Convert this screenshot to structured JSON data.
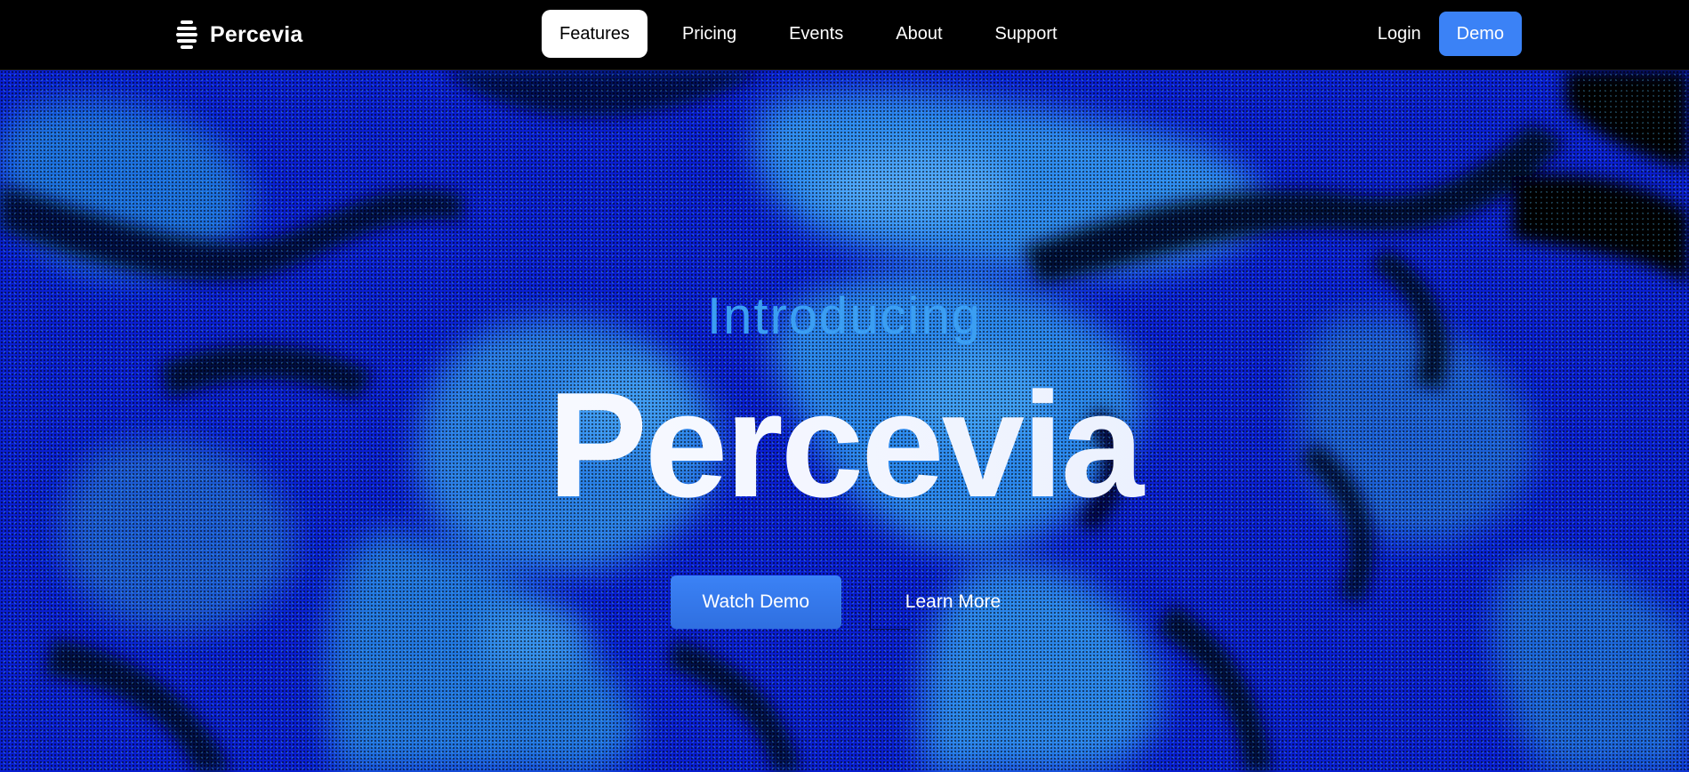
{
  "brand": {
    "name": "Percevia",
    "icon": "stacked-bars-logo-icon"
  },
  "nav": {
    "items": [
      {
        "label": "Features",
        "active": true
      },
      {
        "label": "Pricing",
        "active": false
      },
      {
        "label": "Events",
        "active": false
      },
      {
        "label": "About",
        "active": false
      },
      {
        "label": "Support",
        "active": false
      }
    ],
    "login_label": "Login",
    "demo_label": "Demo"
  },
  "hero": {
    "eyebrow": "Introducing",
    "title": "Percevia",
    "primary_cta": "Watch Demo",
    "secondary_cta": "Learn More",
    "background": "blue-dithered-fluid-pattern"
  },
  "colors": {
    "accent": "#3b82f6",
    "eyebrow": "#3b9ef2",
    "nav_bg": "#000000",
    "hero_deep": "#0a1fd0",
    "hero_light": "#2e8cf0"
  }
}
